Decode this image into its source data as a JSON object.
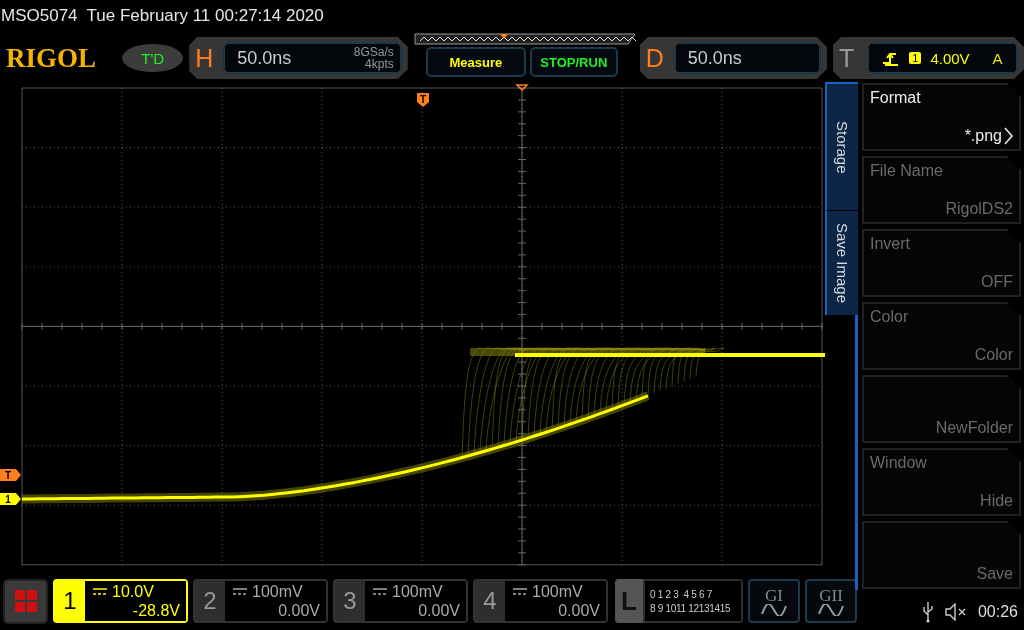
{
  "status_line": {
    "model": "MSO5074",
    "datetime": "Tue February 11 00:27:14 2020"
  },
  "header": {
    "logo": "RIGOL",
    "mode_badge": "T'D",
    "horizontal": {
      "letter": "H",
      "timebase": "50.0ns",
      "sample_rate": "8GSa/s",
      "memory_depth": "4kpts"
    },
    "measure_button": "Measure",
    "run_button": "STOP/RUN",
    "delay": {
      "letter": "D",
      "value": "50.0ns"
    },
    "trigger": {
      "letter": "T",
      "source": "1",
      "level": "4.00V",
      "mode": "A"
    }
  },
  "waveform": {
    "trigger_position_marker": "T",
    "trigger_level_marker": "T",
    "channel_marker": "1"
  },
  "menu": {
    "title": "Storage",
    "subtitle": "Save Image",
    "items": [
      {
        "label": "Format",
        "value": "*.png",
        "disabled": false,
        "submenu": true
      },
      {
        "label": "File Name",
        "value": "RigolDS2",
        "disabled": true,
        "submenu": false
      },
      {
        "label": "Invert",
        "value": "OFF",
        "disabled": true,
        "submenu": false
      },
      {
        "label": "Color",
        "value": "Color",
        "disabled": true,
        "submenu": false
      },
      {
        "value": "NewFolder",
        "disabled": true,
        "submenu": false
      },
      {
        "label": "Window",
        "value": "Hide",
        "disabled": true,
        "submenu": false
      },
      {
        "value": "Save",
        "disabled": true,
        "submenu": false
      }
    ]
  },
  "channels": [
    {
      "number": "1",
      "scale": "10.0V",
      "offset": "-28.8V",
      "on": true
    },
    {
      "number": "2",
      "scale": "100mV",
      "offset": "0.00V",
      "on": false
    },
    {
      "number": "3",
      "scale": "100mV",
      "offset": "0.00V",
      "on": false
    },
    {
      "number": "4",
      "scale": "100mV",
      "offset": "0.00V",
      "on": false
    }
  ],
  "logic": {
    "letter": "L",
    "row_1": "0 1 2 3  4 5 6 7",
    "row_2": "8 9 1011 12131415"
  },
  "generators": [
    {
      "label": "GI"
    },
    {
      "label": "GII"
    }
  ],
  "status": {
    "time": "00:26"
  }
}
